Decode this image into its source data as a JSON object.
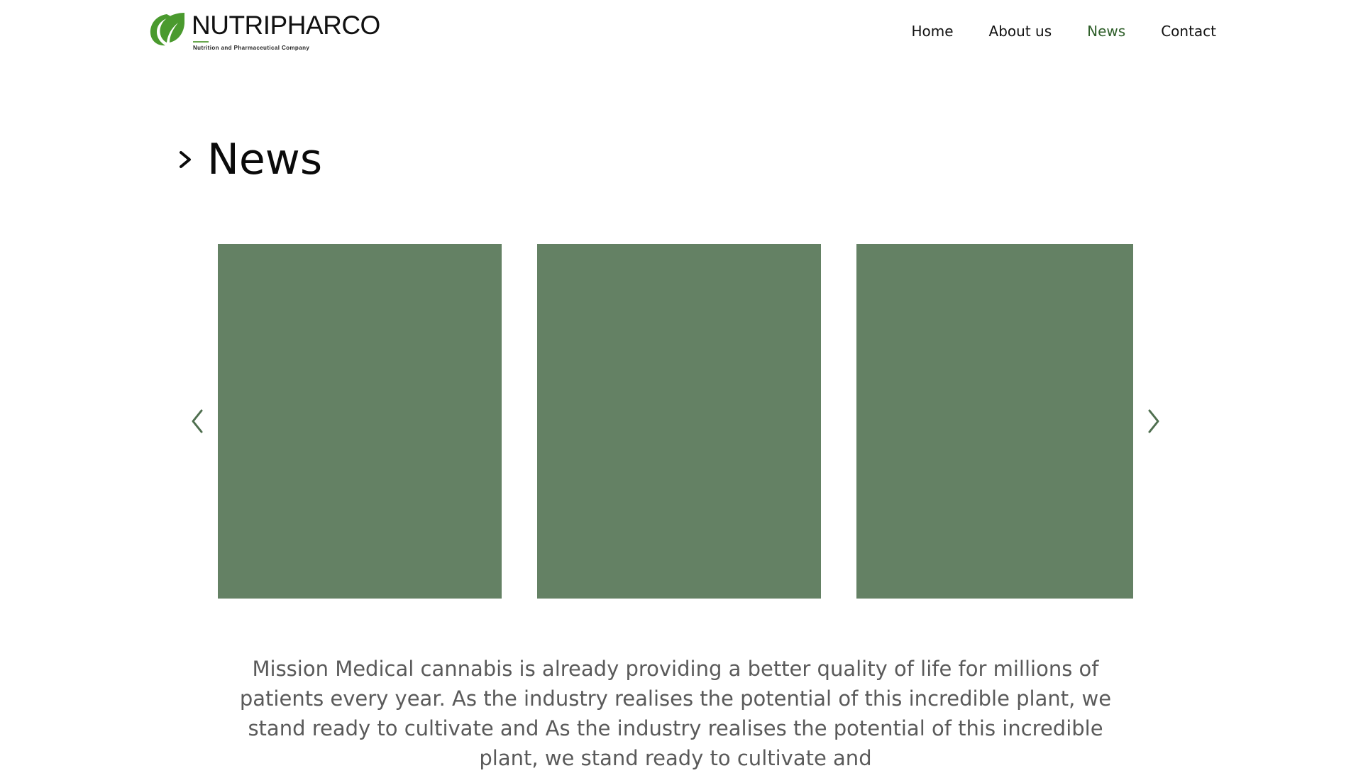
{
  "brand": {
    "name": "NUTRIPHARCO",
    "tagline": "Nutrition and Pharmaceutical Company",
    "leaf_color": "#4a9a2e"
  },
  "nav": {
    "items": [
      {
        "label": "Home"
      },
      {
        "label": "About us"
      },
      {
        "label": "News",
        "active": true
      },
      {
        "label": "Contact"
      }
    ],
    "active_color": "#2f5f2a"
  },
  "section": {
    "title": "News",
    "icon": "chevron-right-icon"
  },
  "carousel": {
    "prev_icon": "chevron-left-icon",
    "next_icon": "chevron-right-icon",
    "slide_color": "#648164",
    "slide_count": 3
  },
  "description": {
    "text": "Mission Medical cannabis is already providing a better quality of life for millions of patients every year. As the industry realises the potential of this incredible plant, we stand ready to cultivate and As the industry realises the potential of this incredible plant, we stand ready to cultivate and"
  }
}
